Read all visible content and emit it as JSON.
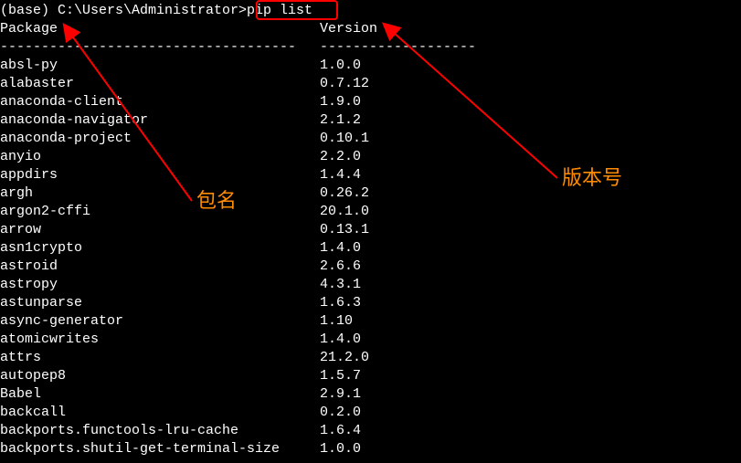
{
  "prompt": {
    "prefix": "(base) C:\\Users\\Administrator>",
    "command": "pip list"
  },
  "headers": {
    "package": "Package",
    "version": "Version"
  },
  "dividers": {
    "package": "------------------------------------",
    "version": "-------------------"
  },
  "packages": [
    {
      "name": "absl-py",
      "version": "1.0.0"
    },
    {
      "name": "alabaster",
      "version": "0.7.12"
    },
    {
      "name": "anaconda-client",
      "version": "1.9.0"
    },
    {
      "name": "anaconda-navigator",
      "version": "2.1.2"
    },
    {
      "name": "anaconda-project",
      "version": "0.10.1"
    },
    {
      "name": "anyio",
      "version": "2.2.0"
    },
    {
      "name": "appdirs",
      "version": "1.4.4"
    },
    {
      "name": "argh",
      "version": "0.26.2"
    },
    {
      "name": "argon2-cffi",
      "version": "20.1.0"
    },
    {
      "name": "arrow",
      "version": "0.13.1"
    },
    {
      "name": "asn1crypto",
      "version": "1.4.0"
    },
    {
      "name": "astroid",
      "version": "2.6.6"
    },
    {
      "name": "astropy",
      "version": "4.3.1"
    },
    {
      "name": "astunparse",
      "version": "1.6.3"
    },
    {
      "name": "async-generator",
      "version": "1.10"
    },
    {
      "name": "atomicwrites",
      "version": "1.4.0"
    },
    {
      "name": "attrs",
      "version": "21.2.0"
    },
    {
      "name": "autopep8",
      "version": "1.5.7"
    },
    {
      "name": "Babel",
      "version": "2.9.1"
    },
    {
      "name": "backcall",
      "version": "0.2.0"
    },
    {
      "name": "backports.functools-lru-cache",
      "version": "1.6.4"
    },
    {
      "name": "backports.shutil-get-terminal-size",
      "version": "1.0.0"
    }
  ],
  "annotations": {
    "packageName": "包名",
    "versionNumber": "版本号"
  }
}
